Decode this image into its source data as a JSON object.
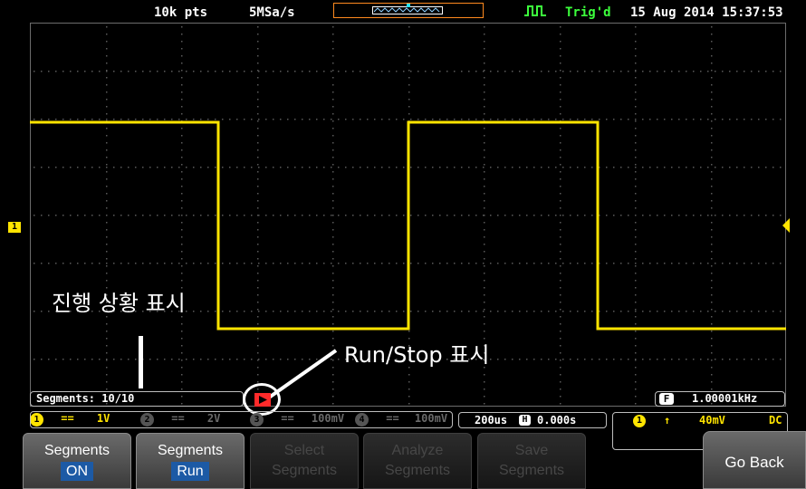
{
  "topbar": {
    "record_length": "10k pts",
    "sample_rate": "5MSa/s",
    "trigger_status": "Trig'd",
    "datetime": "15 Aug 2014 15:37:53"
  },
  "annotations": {
    "progress": "진행 상황 표시",
    "run_stop": "Run/Stop 표시"
  },
  "segments_bar": {
    "label": "Segments: 10/10",
    "frequency": "1.00001kHz",
    "freq_badge": "F"
  },
  "channels": [
    {
      "num": "1",
      "coupling": "==",
      "scale": "1V",
      "color": "#ffe400",
      "active": true
    },
    {
      "num": "2",
      "coupling": "==",
      "scale": "2V",
      "color": "#6a6a6a",
      "active": false
    },
    {
      "num": "3",
      "coupling": "==",
      "scale": "100mV",
      "color": "#6a6a6a",
      "active": false
    },
    {
      "num": "4",
      "coupling": "==",
      "scale": "100mV",
      "color": "#6a6a6a",
      "active": false
    }
  ],
  "timebase": {
    "scale": "200us",
    "badge": "H",
    "position": "0.000s"
  },
  "trigger": {
    "source": "1",
    "slope": "↑",
    "level": "40mV",
    "coupling": "DC"
  },
  "ch1_marker": "1",
  "menu": [
    {
      "line1": "Segments",
      "line2": "ON",
      "state": "active"
    },
    {
      "line1": "Segments",
      "line2": "Run",
      "state": "active"
    },
    {
      "line1": "Select",
      "line2": "Segments",
      "state": "dim"
    },
    {
      "line1": "Analyze",
      "line2": "Segments",
      "state": "dim"
    },
    {
      "line1": "Save",
      "line2": "Segments",
      "state": "dim"
    }
  ],
  "go_back": "Go Back",
  "colors": {
    "trace": "#ffe400",
    "trigger": "#ff5a1f",
    "run_indicator": "#ff2a2a",
    "badge_blue": "#1c5aa5"
  }
}
